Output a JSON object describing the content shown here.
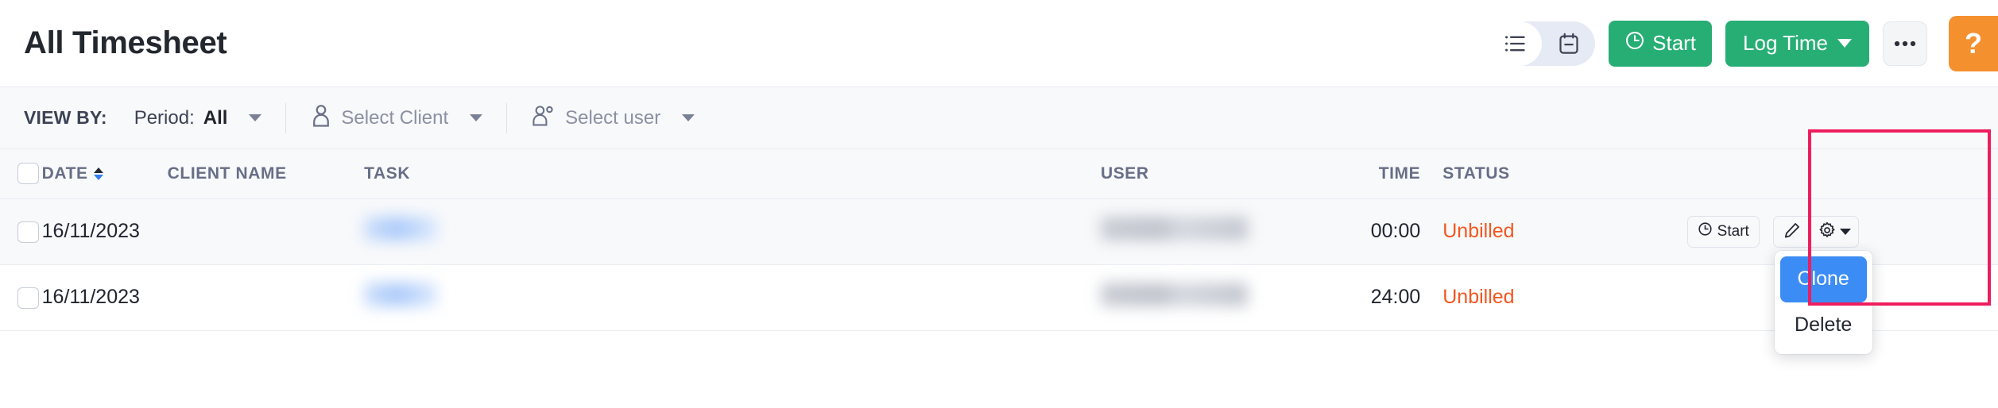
{
  "header": {
    "title": "All Timesheet",
    "view_toggle": [
      {
        "name": "list-view",
        "icon": "list-icon",
        "active": true
      },
      {
        "name": "calendar-view",
        "icon": "calendar-icon",
        "active": false
      }
    ],
    "start_button": "Start",
    "start_icon": "clock-icon",
    "log_time_button": "Log Time",
    "more_button": "•••",
    "more_icon": "ellipsis-icon",
    "help_button": "?",
    "help_icon": "question-mark-icon",
    "accent_green": "#27ae75",
    "accent_orange": "#f5902e"
  },
  "filters": {
    "view_by_label": "VIEW BY:",
    "period_label": "Period:",
    "period_value": "All",
    "select_client": "Select Client",
    "select_user": "Select user"
  },
  "table": {
    "columns": [
      "DATE",
      "CLIENT NAME",
      "TASK",
      "USER",
      "TIME",
      "STATUS"
    ],
    "rows": [
      {
        "date": "16/11/2023",
        "client_name": "",
        "task": "",
        "user": "",
        "time": "00:00",
        "status": "Unbilled",
        "start_label": "Start"
      },
      {
        "date": "16/11/2023",
        "client_name": "",
        "task": "",
        "user": "",
        "time": "24:00",
        "status": "Unbilled",
        "start_label": ""
      }
    ],
    "status_color": "#f4561f"
  },
  "dropdown": {
    "items": [
      {
        "label": "Clone",
        "active": true
      },
      {
        "label": "Delete",
        "active": false
      }
    ],
    "highlight_color": "#ef1d5e",
    "active_color": "#3b8cf5"
  }
}
